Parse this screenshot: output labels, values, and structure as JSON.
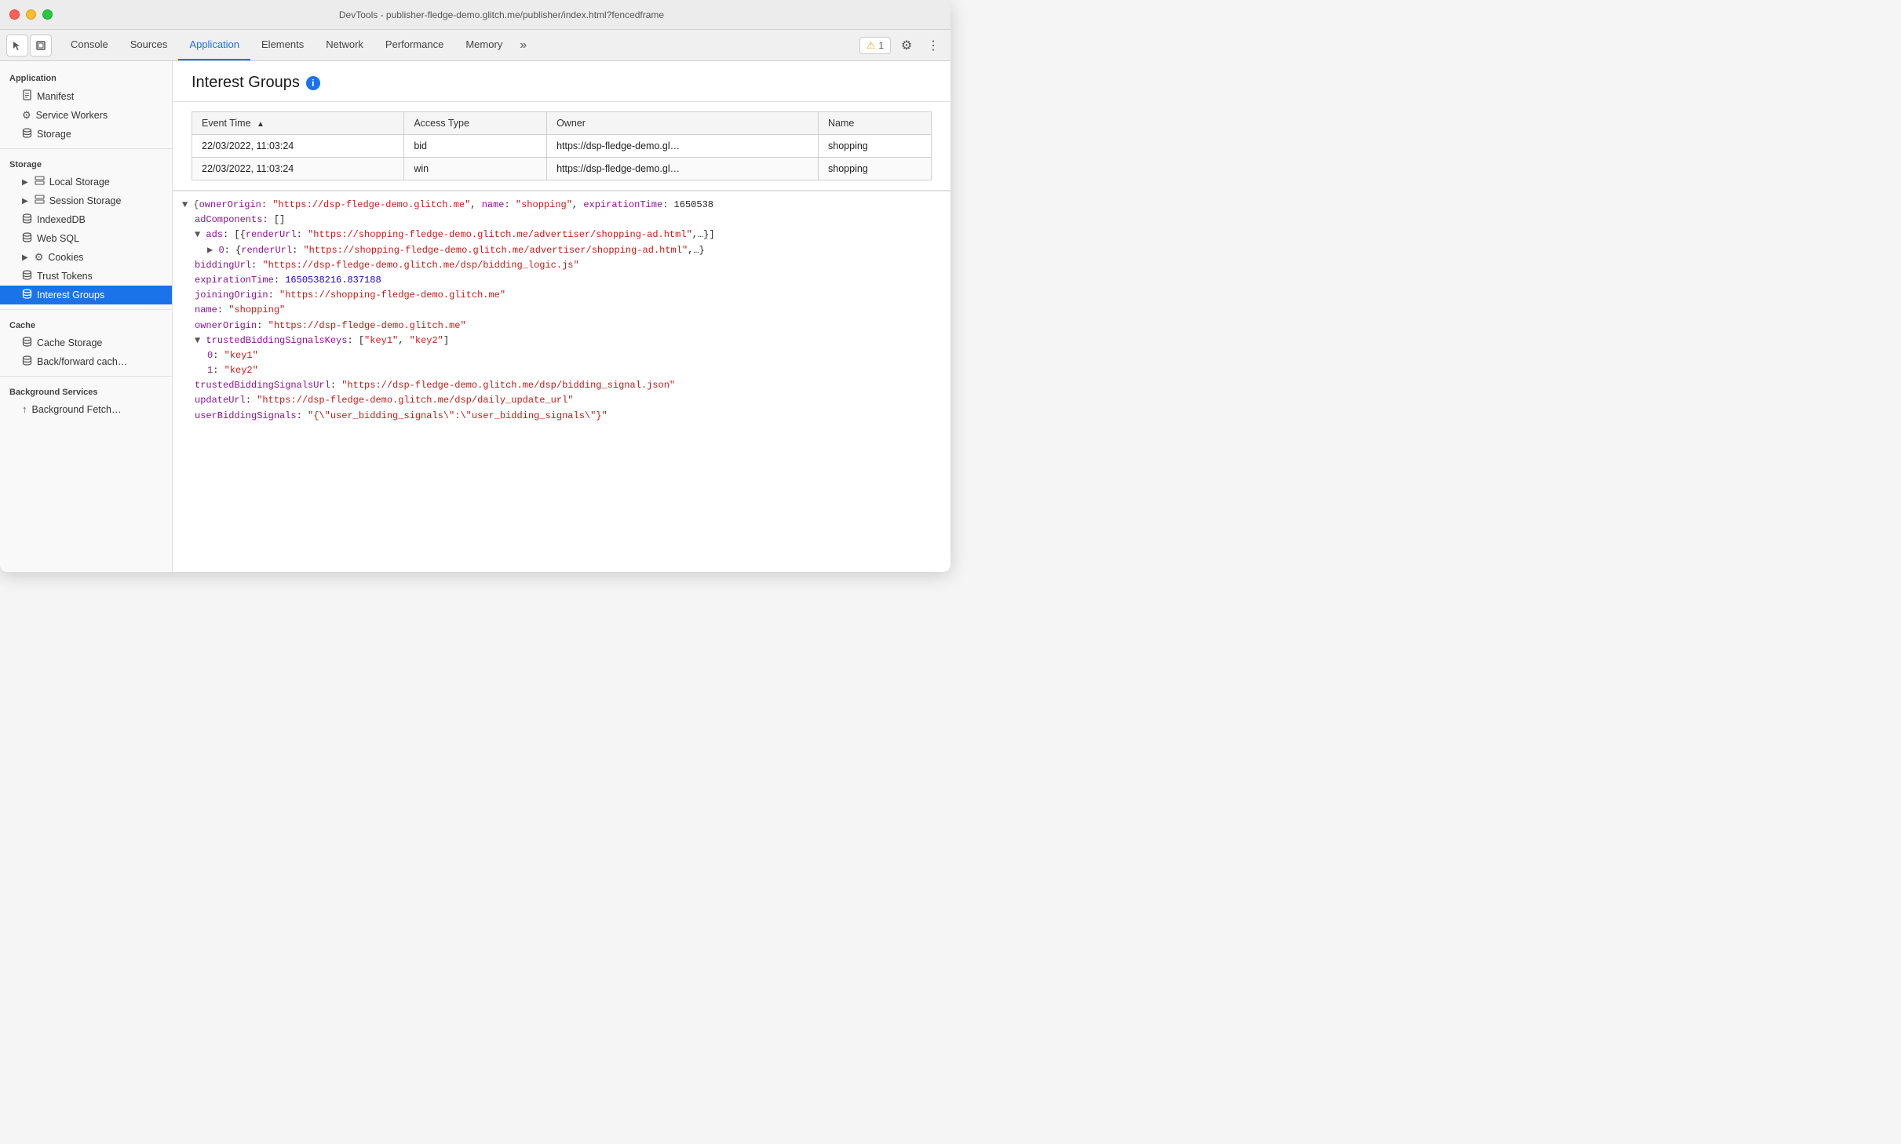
{
  "titlebar": {
    "title": "DevTools - publisher-fledge-demo.glitch.me/publisher/index.html?fencedframe"
  },
  "toolbar": {
    "tabs": [
      {
        "id": "console",
        "label": "Console",
        "active": false
      },
      {
        "id": "sources",
        "label": "Sources",
        "active": false
      },
      {
        "id": "application",
        "label": "Application",
        "active": true
      },
      {
        "id": "elements",
        "label": "Elements",
        "active": false
      },
      {
        "id": "network",
        "label": "Network",
        "active": false
      },
      {
        "id": "performance",
        "label": "Performance",
        "active": false
      },
      {
        "id": "memory",
        "label": "Memory",
        "active": false
      }
    ],
    "more_tabs_icon": "»",
    "warning_count": "1",
    "settings_icon": "⚙",
    "more_icon": "⋮"
  },
  "sidebar": {
    "sections": [
      {
        "title": "Application",
        "items": [
          {
            "id": "manifest",
            "label": "Manifest",
            "icon": "📄",
            "indented": 1,
            "active": false
          },
          {
            "id": "service-workers",
            "label": "Service Workers",
            "icon": "⚙",
            "indented": 1,
            "active": false
          },
          {
            "id": "storage",
            "label": "Storage",
            "icon": "🗄",
            "indented": 1,
            "active": false
          }
        ]
      },
      {
        "title": "Storage",
        "items": [
          {
            "id": "local-storage",
            "label": "Local Storage",
            "icon": "▶",
            "indented": 1,
            "active": false,
            "hasArrow": true
          },
          {
            "id": "session-storage",
            "label": "Session Storage",
            "icon": "▶",
            "indented": 1,
            "active": false,
            "hasArrow": true
          },
          {
            "id": "indexeddb",
            "label": "IndexedDB",
            "icon": "🗄",
            "indented": 1,
            "active": false
          },
          {
            "id": "web-sql",
            "label": "Web SQL",
            "icon": "🗄",
            "indented": 1,
            "active": false
          },
          {
            "id": "cookies",
            "label": "Cookies",
            "icon": "▶",
            "indented": 1,
            "active": false,
            "hasArrow": true
          },
          {
            "id": "trust-tokens",
            "label": "Trust Tokens",
            "icon": "🗄",
            "indented": 1,
            "active": false
          },
          {
            "id": "interest-groups",
            "label": "Interest Groups",
            "icon": "🗄",
            "indented": 1,
            "active": true
          }
        ]
      },
      {
        "title": "Cache",
        "items": [
          {
            "id": "cache-storage",
            "label": "Cache Storage",
            "icon": "🗄",
            "indented": 1,
            "active": false
          },
          {
            "id": "back-forward-cache",
            "label": "Back/forward cach…",
            "icon": "🗄",
            "indented": 1,
            "active": false
          }
        ]
      },
      {
        "title": "Background Services",
        "items": [
          {
            "id": "background-fetch",
            "label": "Background Fetch…",
            "icon": "↑",
            "indented": 1,
            "active": false
          }
        ]
      }
    ]
  },
  "content": {
    "title": "Interest Groups",
    "table": {
      "columns": [
        {
          "id": "event-time",
          "label": "Event Time",
          "sortable": true
        },
        {
          "id": "access-type",
          "label": "Access Type"
        },
        {
          "id": "owner",
          "label": "Owner"
        },
        {
          "id": "name",
          "label": "Name"
        }
      ],
      "rows": [
        {
          "event_time": "22/03/2022, 11:03:24",
          "access_type": "bid",
          "owner": "https://dsp-fledge-demo.gl…",
          "name": "shopping"
        },
        {
          "event_time": "22/03/2022, 11:03:24",
          "access_type": "win",
          "owner": "https://dsp-fledge-demo.gl…",
          "name": "shopping"
        }
      ]
    },
    "detail": {
      "lines": [
        {
          "type": "mixed",
          "indent": 0,
          "parts": [
            {
              "text": "▼ {",
              "class": "json-toggle"
            },
            {
              "text": "ownerOrigin",
              "class": "json-key"
            },
            {
              "text": ": ",
              "class": "json-brace"
            },
            {
              "text": "\"https://dsp-fledge-demo.glitch.me\"",
              "class": "json-string"
            },
            {
              "text": ", ",
              "class": "json-brace"
            },
            {
              "text": "name",
              "class": "json-key"
            },
            {
              "text": ": ",
              "class": "json-brace"
            },
            {
              "text": "\"shopping\"",
              "class": "json-string"
            },
            {
              "text": ", ",
              "class": "json-brace"
            },
            {
              "text": "expirationTime",
              "class": "json-key"
            },
            {
              "text": ": 1650538",
              "class": "json-brace"
            }
          ]
        },
        {
          "type": "mixed",
          "indent": 1,
          "parts": [
            {
              "text": "adComponents",
              "class": "json-key"
            },
            {
              "text": ": []",
              "class": "json-brace"
            }
          ]
        },
        {
          "type": "mixed",
          "indent": 1,
          "parts": [
            {
              "text": "▼ ",
              "class": "json-toggle"
            },
            {
              "text": "ads",
              "class": "json-key"
            },
            {
              "text": ": [{",
              "class": "json-brace"
            },
            {
              "text": "renderUrl",
              "class": "json-key"
            },
            {
              "text": ": ",
              "class": "json-brace"
            },
            {
              "text": "\"https://shopping-fledge-demo.glitch.me/advertiser/shopping-ad.html\"",
              "class": "json-string"
            },
            {
              "text": ",…}]",
              "class": "json-brace"
            }
          ]
        },
        {
          "type": "mixed",
          "indent": 2,
          "parts": [
            {
              "text": "▶ ",
              "class": "json-toggle"
            },
            {
              "text": "0",
              "class": "json-key"
            },
            {
              "text": ": {",
              "class": "json-brace"
            },
            {
              "text": "renderUrl",
              "class": "json-key"
            },
            {
              "text": ": ",
              "class": "json-brace"
            },
            {
              "text": "\"https://shopping-fledge-demo.glitch.me/advertiser/shopping-ad.html\"",
              "class": "json-string"
            },
            {
              "text": ",…}",
              "class": "json-brace"
            }
          ]
        },
        {
          "type": "mixed",
          "indent": 1,
          "parts": [
            {
              "text": "biddingUrl",
              "class": "json-key"
            },
            {
              "text": ": ",
              "class": "json-brace"
            },
            {
              "text": "\"https://dsp-fledge-demo.glitch.me/dsp/bidding_logic.js\"",
              "class": "json-url"
            }
          ]
        },
        {
          "type": "mixed",
          "indent": 1,
          "parts": [
            {
              "text": "expirationTime",
              "class": "json-key"
            },
            {
              "text": ": ",
              "class": "json-brace"
            },
            {
              "text": "1650538216.837188",
              "class": "json-number"
            }
          ]
        },
        {
          "type": "mixed",
          "indent": 1,
          "parts": [
            {
              "text": "joiningOrigin",
              "class": "json-key"
            },
            {
              "text": ": ",
              "class": "json-brace"
            },
            {
              "text": "\"https://shopping-fledge-demo.glitch.me\"",
              "class": "json-url"
            }
          ]
        },
        {
          "type": "mixed",
          "indent": 1,
          "parts": [
            {
              "text": "name",
              "class": "json-key"
            },
            {
              "text": ": ",
              "class": "json-brace"
            },
            {
              "text": "\"shopping\"",
              "class": "json-url"
            }
          ]
        },
        {
          "type": "mixed",
          "indent": 1,
          "parts": [
            {
              "text": "ownerOrigin",
              "class": "json-key"
            },
            {
              "text": ": ",
              "class": "json-brace"
            },
            {
              "text": "\"https://dsp-fledge-demo.glitch.me\"",
              "class": "json-url"
            }
          ]
        },
        {
          "type": "mixed",
          "indent": 1,
          "parts": [
            {
              "text": "▼ ",
              "class": "json-toggle"
            },
            {
              "text": "trustedBiddingSignalsKeys",
              "class": "json-key"
            },
            {
              "text": ": [",
              "class": "json-brace"
            },
            {
              "text": "\"key1\"",
              "class": "json-string"
            },
            {
              "text": ", ",
              "class": "json-brace"
            },
            {
              "text": "\"key2\"",
              "class": "json-string"
            },
            {
              "text": "]",
              "class": "json-brace"
            }
          ]
        },
        {
          "type": "mixed",
          "indent": 2,
          "parts": [
            {
              "text": "0",
              "class": "json-key"
            },
            {
              "text": ": ",
              "class": "json-brace"
            },
            {
              "text": "\"key1\"",
              "class": "json-url"
            }
          ]
        },
        {
          "type": "mixed",
          "indent": 2,
          "parts": [
            {
              "text": "1",
              "class": "json-key"
            },
            {
              "text": ": ",
              "class": "json-brace"
            },
            {
              "text": "\"key2\"",
              "class": "json-url"
            }
          ]
        },
        {
          "type": "mixed",
          "indent": 1,
          "parts": [
            {
              "text": "trustedBiddingSignalsUrl",
              "class": "json-key"
            },
            {
              "text": ": ",
              "class": "json-brace"
            },
            {
              "text": "\"https://dsp-fledge-demo.glitch.me/dsp/bidding_signal.json\"",
              "class": "json-url"
            }
          ]
        },
        {
          "type": "mixed",
          "indent": 1,
          "parts": [
            {
              "text": "updateUrl",
              "class": "json-key"
            },
            {
              "text": ": ",
              "class": "json-brace"
            },
            {
              "text": "\"https://dsp-fledge-demo.glitch.me/dsp/daily_update_url\"",
              "class": "json-url"
            }
          ]
        },
        {
          "type": "mixed",
          "indent": 1,
          "parts": [
            {
              "text": "userBiddingSignals",
              "class": "json-key"
            },
            {
              "text": ": ",
              "class": "json-brace"
            },
            {
              "text": "\"{\\\"user_bidding_signals\\\":\\\"user_bidding_signals\\\"}\"",
              "class": "json-url"
            }
          ]
        }
      ]
    }
  }
}
